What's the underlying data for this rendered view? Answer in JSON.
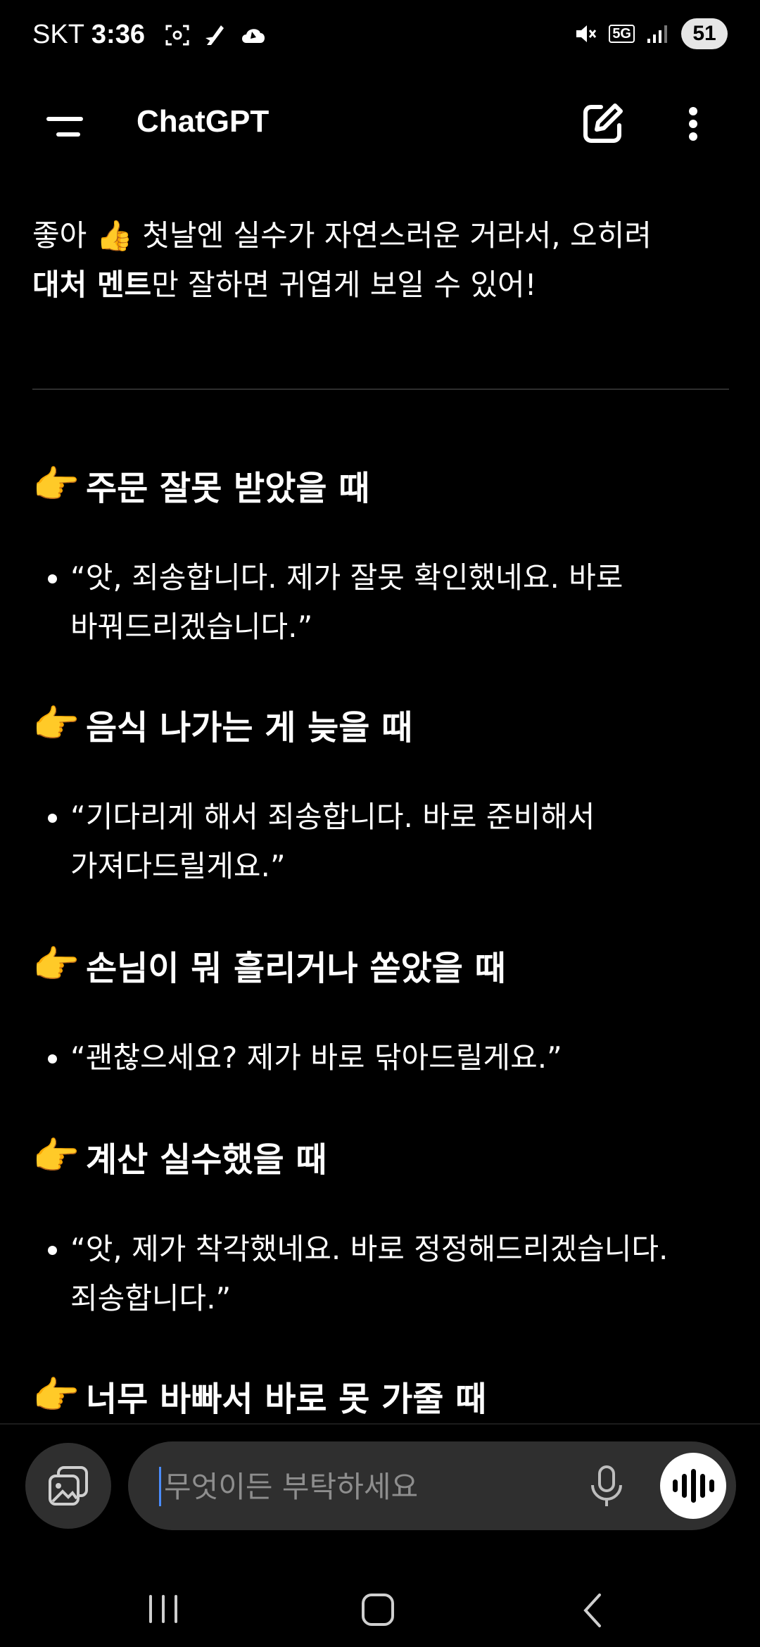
{
  "status_bar": {
    "carrier": "SKT",
    "time": "3:36",
    "network": "5G",
    "battery": "51"
  },
  "header": {
    "title": "ChatGPT"
  },
  "message": {
    "intro_line1": "좋아 👍 첫날엔 실수가 자연스러운 거라서, 오히려",
    "intro_bold": "대처 멘트",
    "intro_rest": "만 잘하면 귀엽게 보일 수 있어!",
    "pointer_emoji": "👉",
    "sections": [
      {
        "heading": "주문 잘못 받았을 때",
        "lines": [
          "“앗, 죄송합니다. 제가 잘못 확인했네요. 바로",
          "바꿔드리겠습니다.”"
        ]
      },
      {
        "heading": "음식 나가는 게 늦을 때",
        "lines": [
          "“기다리게 해서 죄송합니다. 바로 준비해서",
          "가져다드릴게요.”"
        ]
      },
      {
        "heading": "손님이 뭐 흘리거나 쏟았을 때",
        "lines": [
          "“괜찮으세요? 제가 바로 닦아드릴게요.”"
        ]
      },
      {
        "heading": "계산 실수했을 때",
        "lines": [
          "“앗, 제가 착각했네요. 바로 정정해드리겠습니다.",
          "죄송합니다.”"
        ]
      },
      {
        "heading": "너무 바빠서 바로 못 가줄 때"
      }
    ]
  },
  "composer": {
    "placeholder": "무엇이든 부탁하세요"
  },
  "icons": {
    "menu": "menu-icon",
    "edit": "new-chat-icon",
    "more": "more-vertical-icon",
    "attach": "image-attach-icon",
    "mic": "mic-icon",
    "voice": "voice-mode-icon"
  }
}
